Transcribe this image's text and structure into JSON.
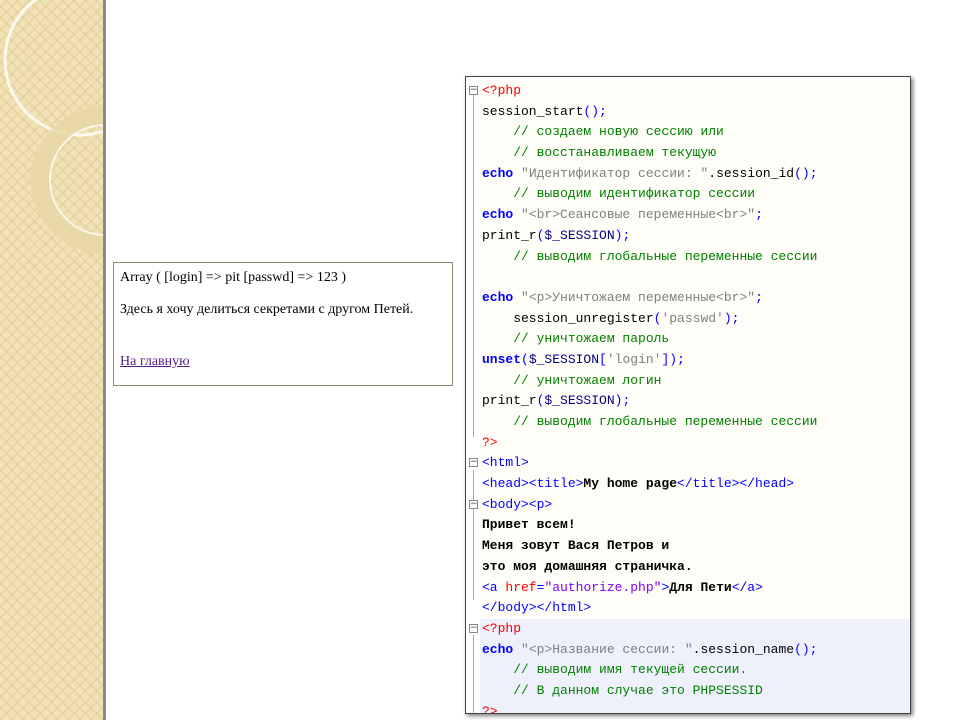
{
  "output": {
    "array_line": "Array ( [login] => pit [passwd] => 123 )",
    "message": "Здесь я хочу делиться секретами с другом Петей.",
    "home_link": "На главную"
  },
  "code": {
    "l01": "<?php",
    "l02_fn": "session_start",
    "l02_p": "();",
    "l03": "    // создаем новую сессию или",
    "l04": "    // восстанавливаем текущую",
    "l05_kw": "echo",
    "l05_str": " \"Идентификатор сессии: \"",
    "l05_fn": ".session_id",
    "l05_p": "();",
    "l06": "    // выводим идентификатор сессии",
    "l07_kw": "echo",
    "l07_str": " \"<br>Сеансовые переменные<br>\"",
    "l07_p": ";",
    "l08_fn": "print_r",
    "l08_p1": "(",
    "l08_var": "$_SESSION",
    "l08_p2": ");",
    "l09": "    // выводим глобальные переменные сессии",
    "l10": "",
    "l11_kw": "echo",
    "l11_str": " \"<p>Уничтожаем переменные<br>\"",
    "l11_p": ";",
    "l12_fn": "    session_unregister",
    "l12_p1": "(",
    "l12_str": "'passwd'",
    "l12_p2": ");",
    "l13": "    // уничтожаем пароль",
    "l14_kw": "unset",
    "l14_p1": "(",
    "l14_var": "$_SESSION",
    "l14_p2": "[",
    "l14_str": "'login'",
    "l14_p3": "]);",
    "l15": "    // уничтожаем логин",
    "l16_fn": "print_r",
    "l16_p1": "(",
    "l16_var": "$_SESSION",
    "l16_p2": ");",
    "l17": "    // выводим глобальные переменные сессии",
    "l18": "?>",
    "l19": "<html>",
    "l20_t1": "<head><title>",
    "l20_txt": "My home page",
    "l20_t2": "</title></head>",
    "l21": "<body><p>",
    "l22": "Привет всем!",
    "l23": "Меня зовут Вася Петров и",
    "l24": "это моя домашняя страничка.",
    "l25_t1": "<a ",
    "l25_attr": "href",
    "l25_eq": "=",
    "l25_val": "\"authorize.php\"",
    "l25_t2": ">",
    "l25_txt": "Для Пети",
    "l25_t3": "</a>",
    "l26": "</body></html>",
    "l27": "<?php",
    "l28_kw": "echo",
    "l28_str": " \"<p>Название сессии: \"",
    "l28_fn": ".session_name",
    "l28_p": "();",
    "l29": "    // выводим имя текущей сессии.",
    "l30": "    // В данном случае это PHPSESSID",
    "l31": "?>"
  },
  "colors": {
    "keyword": "#0000ff",
    "comment": "#008000",
    "string": "#808080",
    "php_tag": "#ff0000",
    "attr_value": "#8000ff",
    "background_strip": "#f1e2b6"
  }
}
